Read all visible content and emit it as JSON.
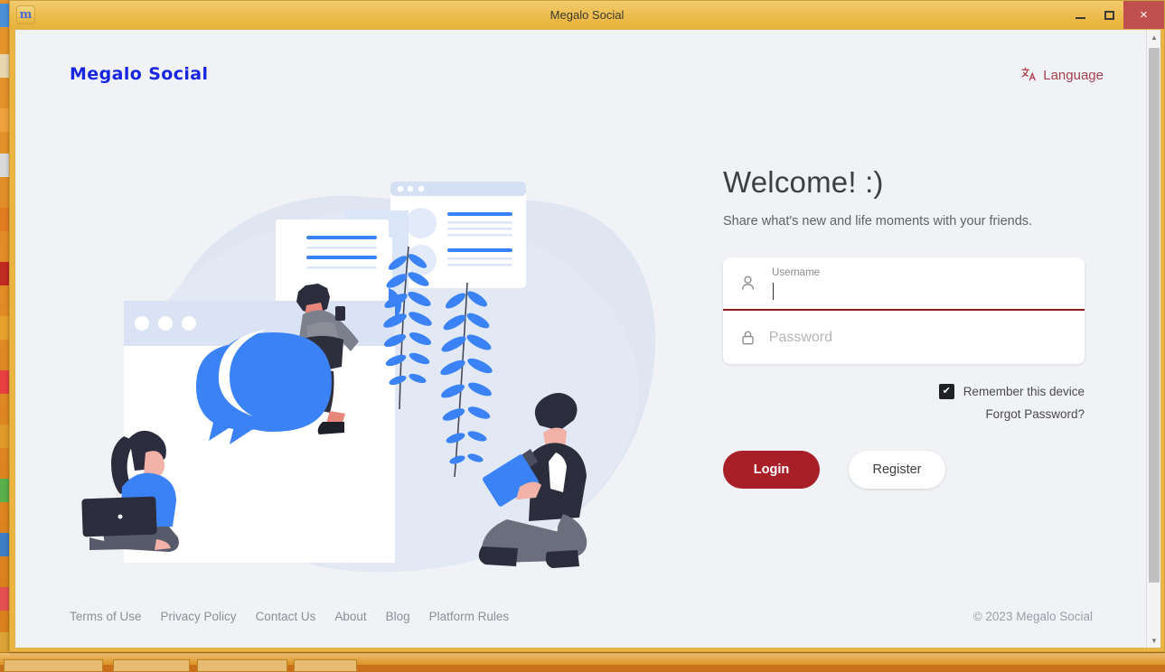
{
  "window": {
    "title": "Megalo Social",
    "app_icon": "m",
    "controls": {
      "minimize": "minimize-icon",
      "maximize": "maximize-icon",
      "close": "×"
    }
  },
  "header": {
    "brand": "Megalo Social",
    "language": {
      "label": "Language",
      "icon": "文A"
    }
  },
  "main": {
    "heading": "Welcome! :)",
    "subtitle": "Share what's new and life moments with your friends.",
    "form": {
      "username": {
        "label": "Username",
        "placeholder": "Username",
        "value": "",
        "icon": "user-icon",
        "focused": true
      },
      "password": {
        "label": "Password",
        "placeholder": "Password",
        "value": "",
        "icon": "lock-icon",
        "focused": false
      },
      "remember": {
        "label": "Remember this device",
        "checked": true,
        "check_glyph": "✔"
      },
      "forgot_password": "Forgot Password?",
      "login_button": "Login",
      "register_button": "Register"
    }
  },
  "footer": {
    "links": [
      "Terms of Use",
      "Privacy Policy",
      "Contact Us",
      "About",
      "Blog",
      "Platform Rules"
    ],
    "copyright": "© 2023 Megalo Social"
  },
  "colors": {
    "brand_blue": "#1926e0",
    "accent_red": "#a81f28",
    "language_red": "#a4414f",
    "page_bg": "#f0f2f5",
    "titlebar": "#edbc4d",
    "close_button": "#c0504d",
    "illustration_blue": "#3b82f6",
    "illustration_light": "#dbe4f3"
  },
  "scrollbar": {
    "up_arrow": "▲",
    "down_arrow": "▼"
  }
}
